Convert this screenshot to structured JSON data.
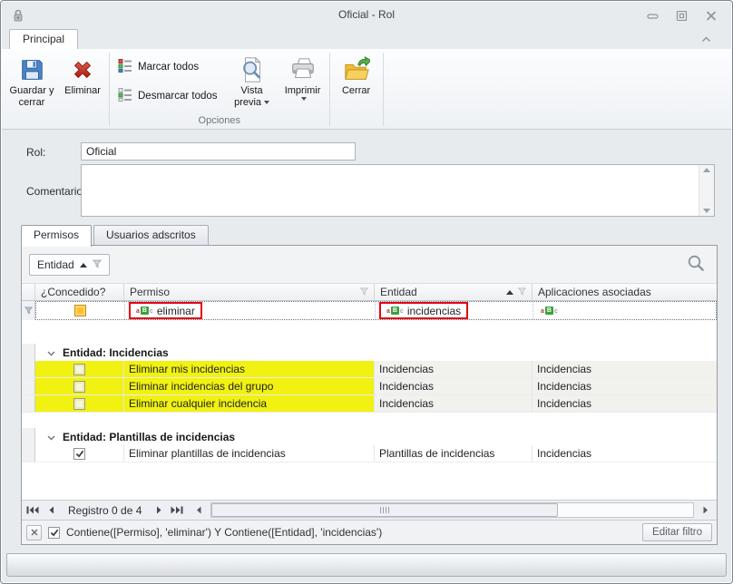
{
  "window": {
    "title": "Oficial - Rol"
  },
  "ribbon": {
    "tab_label": "Principal",
    "save_close_label": "Guardar y cerrar",
    "delete_label": "Eliminar",
    "mark_all_label": "Marcar todos",
    "unmark_all_label": "Desmarcar todos",
    "preview_label": "Vista previa",
    "print_label": "Imprimir",
    "close_label": "Cerrar",
    "group_caption": "Opciones"
  },
  "form": {
    "rol_label": "Rol:",
    "rol_value": "Oficial",
    "comments_label": "Comentarios:",
    "comments_value": ""
  },
  "tabs": {
    "permisos": "Permisos",
    "usuarios": "Usuarios adscritos"
  },
  "grid": {
    "group_by_field": "Entidad",
    "columns": {
      "granted": "¿Concedido?",
      "permission": "Permiso",
      "entity": "Entidad",
      "apps": "Aplicaciones asociadas"
    },
    "abc_icon": {
      "a": "a",
      "b": "B",
      "c": "c"
    },
    "filter_row": {
      "permission_value": "eliminar",
      "entity_value": "incidencias"
    },
    "groups": [
      {
        "label": "Entidad: Incidencias",
        "rows": [
          {
            "granted": false,
            "permission": "Eliminar mis incidencias",
            "entity": "Incidencias",
            "apps": "Incidencias",
            "highlighted": true
          },
          {
            "granted": false,
            "permission": "Eliminar incidencias del grupo",
            "entity": "Incidencias",
            "apps": "Incidencias",
            "highlighted": true
          },
          {
            "granted": false,
            "permission": "Eliminar cualquier incidencia",
            "entity": "Incidencias",
            "apps": "Incidencias",
            "highlighted": true
          }
        ]
      },
      {
        "label": "Entidad: Plantillas de incidencias",
        "rows": [
          {
            "granted": true,
            "permission": "Eliminar plantillas de incidencias",
            "entity": "Plantillas de incidencias",
            "apps": "Incidencias",
            "highlighted": false
          }
        ]
      }
    ],
    "navigator": {
      "label": "Registro 0 de 4"
    },
    "filter_bar": {
      "text": "Contiene([Permiso], 'eliminar') Y Contiene([Entidad], 'incidencias')",
      "edit_button": "Editar filtro"
    }
  },
  "icons": {
    "app": "lock-icon",
    "minimize": "minimize-icon",
    "restore": "restore-icon",
    "close": "close-icon",
    "save_close": "floppy-disk-icon",
    "delete": "red-x-icon",
    "mark_all": "checklist-icon",
    "unmark_all": "checklist-icon",
    "preview": "magnifier-page-icon",
    "print": "printer-icon",
    "close_form": "folder-green-arrow-icon",
    "search": "magnifier-icon",
    "filter": "funnel-icon",
    "sort": "sort-asc-arrow",
    "collapse_ribbon": "chevron-up-icon",
    "group_expand": "chevron-down-icon",
    "text_filter": "abc-filter-icon"
  },
  "colors": {
    "highlight_yellow": "#f1f112",
    "annotation_red": "#e30613",
    "abc_green": "#3ca03c",
    "filter_checkbox_amber": "#ffc233"
  }
}
